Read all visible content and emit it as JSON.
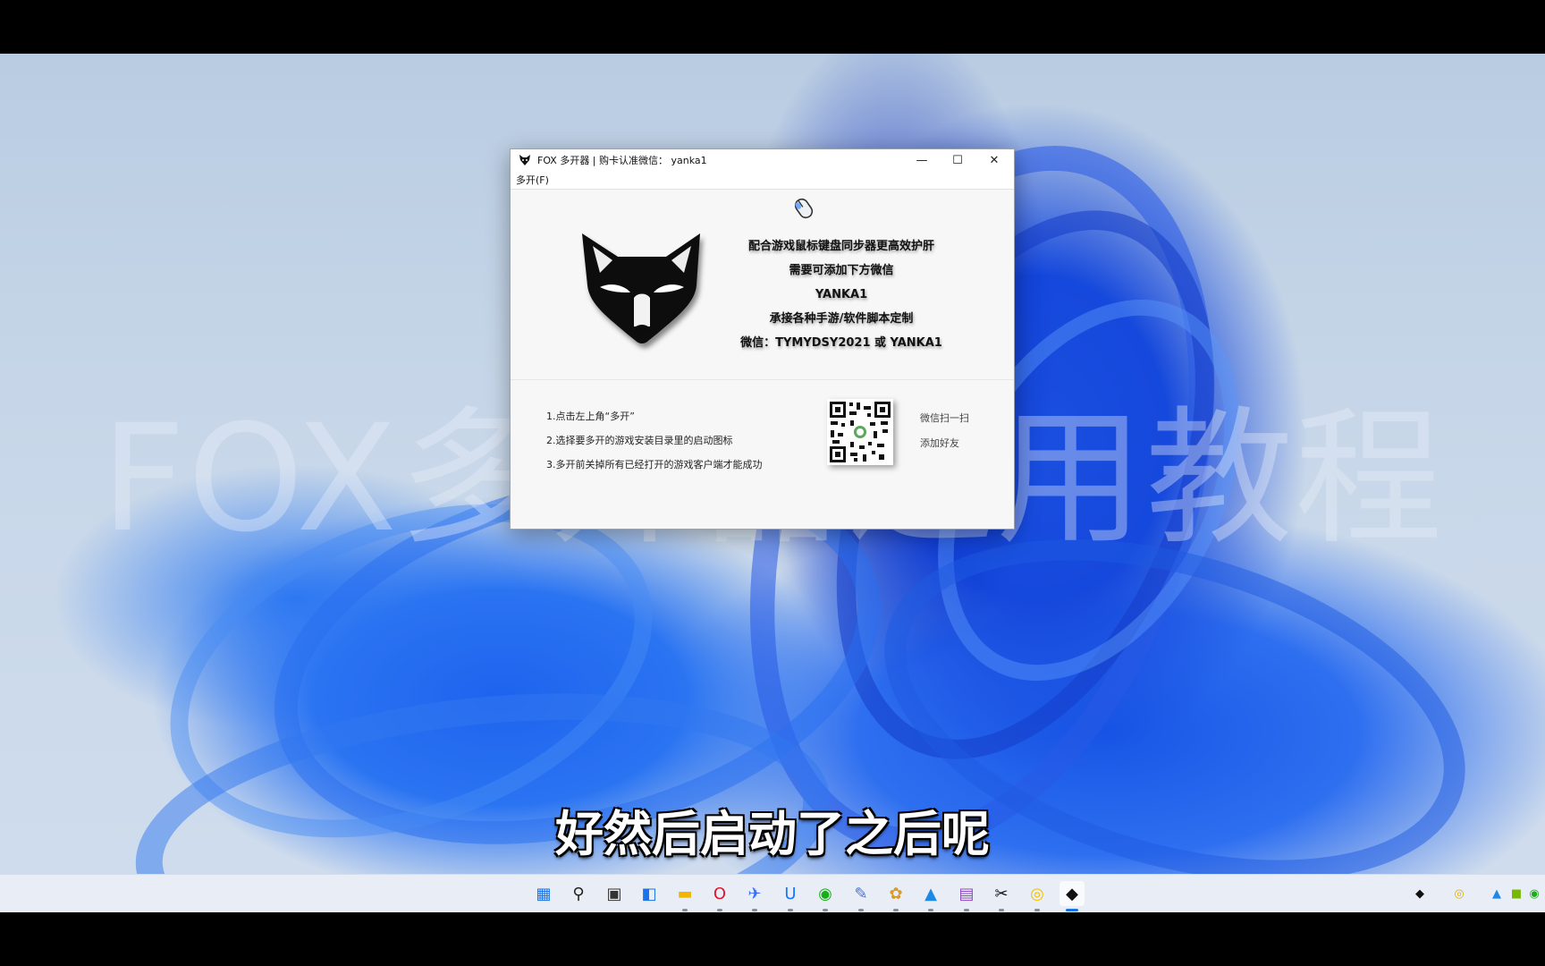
{
  "window": {
    "title": "FOX 多开器 | 购卡认准微信： yanka1",
    "min_symbol": "—",
    "max_symbol": "☐",
    "close_symbol": "✕",
    "menu": [
      "多开(F)"
    ]
  },
  "promo_lines": [
    "配合游戏鼠标键盘同步器更高效护肝",
    "需要可添加下方微信",
    "YANKA1",
    "承接各种手游/软件脚本定制",
    "微信：TYMYDSY2021 或 YANKA1"
  ],
  "steps": [
    "1.点击左上角“多开”",
    "2.选择要多开的游戏安装目录里的启动图标",
    "3.多开前关掉所有已经打开的游戏客户端才能成功"
  ],
  "qr_labels": [
    "微信扫一扫",
    "添加好友"
  ],
  "watermark": "FOX多开器通用教程",
  "subtitle": "好然后启动了之后呢",
  "taskbar": {
    "icons": [
      {
        "name": "start-icon",
        "glyph": "▦",
        "color": "#1a73e8"
      },
      {
        "name": "search-icon",
        "glyph": "⚲",
        "color": "#222222"
      },
      {
        "name": "task-view-icon",
        "glyph": "▣",
        "color": "#333333"
      },
      {
        "name": "widgets-icon",
        "glyph": "◧",
        "color": "#1a73e8"
      },
      {
        "name": "file-explorer-icon",
        "glyph": "▬",
        "color": "#f2b500"
      },
      {
        "name": "opera-icon",
        "glyph": "O",
        "color": "#e3142c"
      },
      {
        "name": "feishu-icon",
        "glyph": "✈",
        "color": "#3370ff"
      },
      {
        "name": "todesk-icon",
        "glyph": "U",
        "color": "#1677ff"
      },
      {
        "name": "wechat-icon",
        "glyph": "◉",
        "color": "#1aad19"
      },
      {
        "name": "app-icon-tools",
        "glyph": "✎",
        "color": "#4a6fd0"
      },
      {
        "name": "app-icon-paint",
        "glyph": "✿",
        "color": "#d99a2b"
      },
      {
        "name": "app-icon-blue",
        "glyph": "▲",
        "color": "#1e88e5"
      },
      {
        "name": "winrar-icon",
        "glyph": "▤",
        "color": "#8c4bbf"
      },
      {
        "name": "capcut-icon",
        "glyph": "✂",
        "color": "#111111"
      },
      {
        "name": "app-icon-yellow",
        "glyph": "◎",
        "color": "#f0c000"
      },
      {
        "name": "fox-app-icon",
        "glyph": "◆",
        "color": "#111111"
      }
    ],
    "tray": [
      {
        "name": "tray-fox-icon",
        "glyph": "◆",
        "color": "#111111"
      },
      {
        "name": "tray-yellow-icon",
        "glyph": "◎",
        "color": "#e0b000"
      },
      {
        "name": "tray-app-icon",
        "glyph": "▲",
        "color": "#1e88e5"
      },
      {
        "name": "tray-nvidia-icon",
        "glyph": "■",
        "color": "#76b900"
      },
      {
        "name": "tray-chat-icon",
        "glyph": "◉",
        "color": "#1aad19"
      }
    ]
  }
}
